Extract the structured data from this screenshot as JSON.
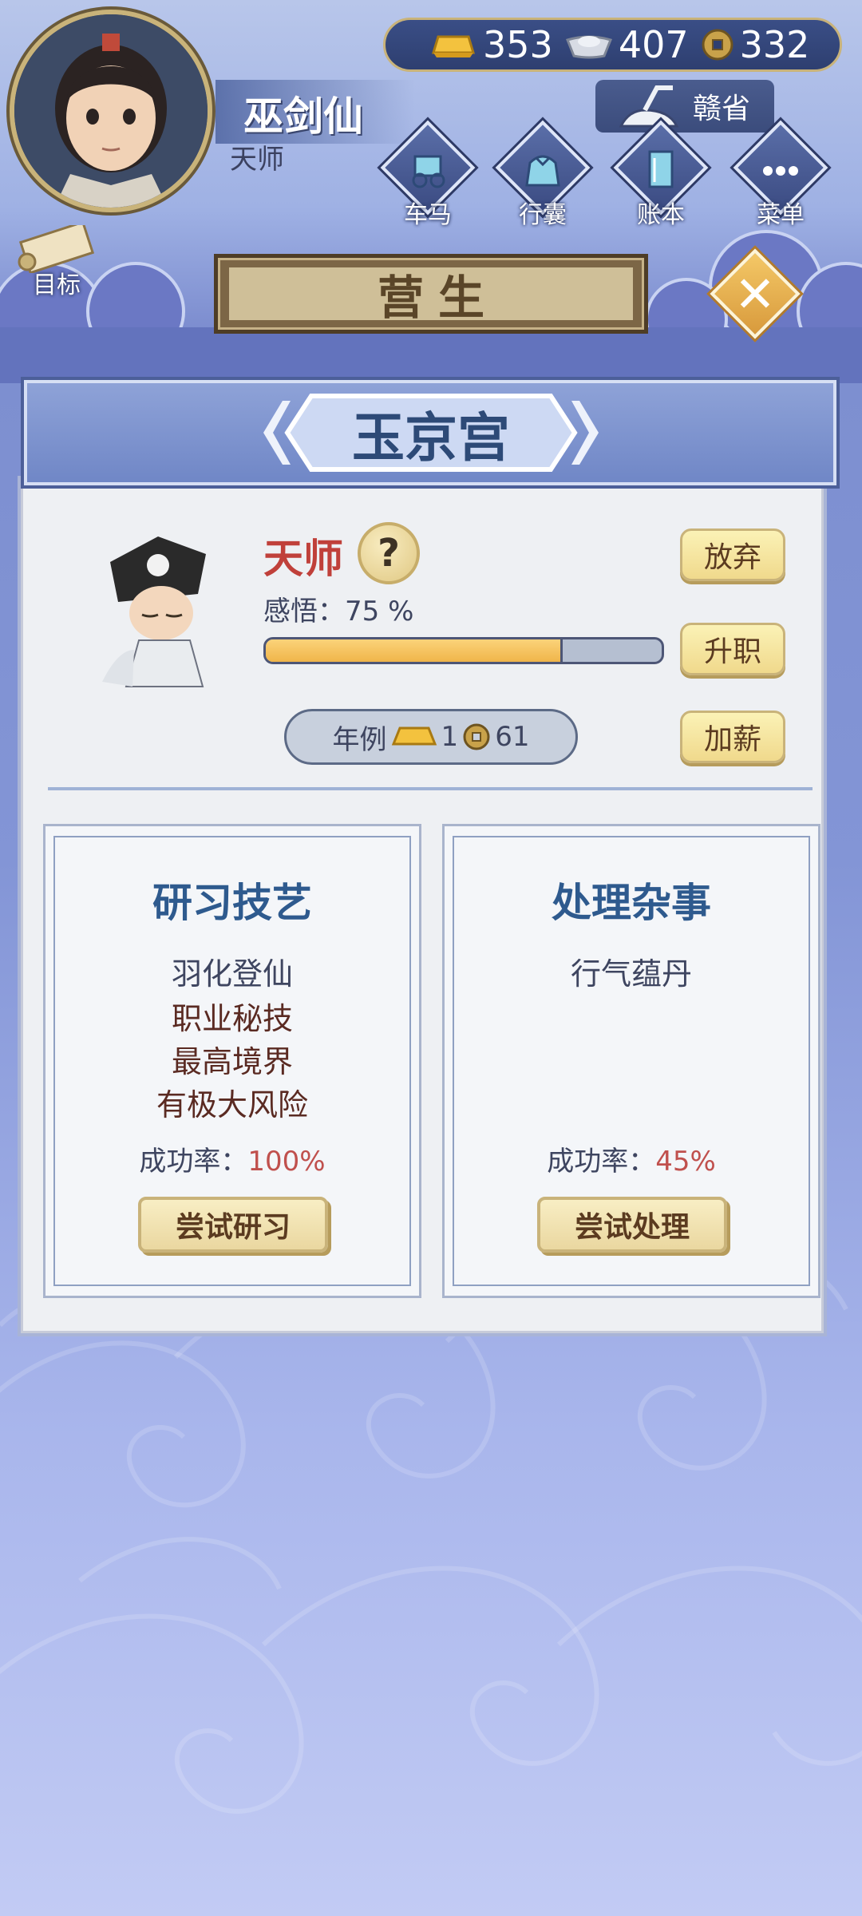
{
  "player": {
    "name": "巫剑仙",
    "rank": "天师"
  },
  "currency": {
    "gold": "353",
    "silver": "407",
    "coin": "332"
  },
  "region": "赣省",
  "menu": {
    "cart": "车马",
    "bag": "行囊",
    "ledger": "账本",
    "menu": "菜单"
  },
  "target_label": "目标",
  "screen_title": "营生",
  "place": "玉京宫",
  "job": {
    "title": "天师",
    "insight_label": "感悟：",
    "insight_value": "75 %",
    "insight_progress": 0.75,
    "salary_label": "年例",
    "salary_gold": "1",
    "salary_coin": "61"
  },
  "actions": {
    "abandon": "放弃",
    "promote": "升职",
    "raise": "加薪"
  },
  "cards": [
    {
      "title": "研习技艺",
      "line1": "羽化登仙",
      "line2": "职业秘技",
      "line3": "最高境界",
      "line4": "有极大风险",
      "rate_label": "成功率：",
      "rate_value": "100%",
      "button": "尝试研习"
    },
    {
      "title": "处理杂事",
      "line1": "行气蕴丹",
      "rate_label": "成功率：",
      "rate_value": "45%",
      "button": "尝试处理"
    }
  ],
  "colors": {
    "accent_gold": "#f0b54a",
    "title_blue": "#2e5a8e",
    "rank_red": "#c0403a"
  }
}
